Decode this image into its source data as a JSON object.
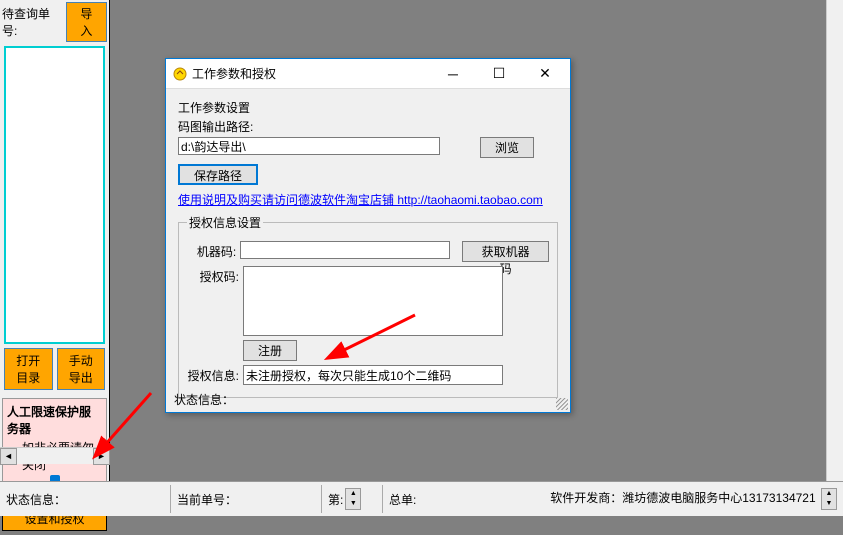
{
  "sidebar": {
    "query_label": "待查询单号:",
    "import_btn": "导入",
    "open_dir_btn": "打开目录",
    "manual_export_btn": "手动导出",
    "rate_limit_title": "人工限速保护服务器",
    "rate_limit_checkbox": "如非必要请勿关闭",
    "rate_limit_checked": true,
    "settings_btn": "设置和授权"
  },
  "dialog": {
    "title": "工作参数和授权",
    "section_params": "工作参数设置",
    "path_label": "码图输出路径:",
    "path_value": "d:\\韵达导出\\",
    "browse_btn": "浏览",
    "save_path_btn": "保存路径",
    "link_text": "使用说明及购买请访问德波软件淘宝店铺  http://taohaomi.taobao.com",
    "link_url": "http://taohaomi.taobao.com",
    "auth_section": "授权信息设置",
    "machine_code_label": "机器码:",
    "machine_code_value": "",
    "get_machine_code_btn": "获取机器码",
    "auth_code_label": "授权码:",
    "auth_code_value": "",
    "register_btn": "注册",
    "auth_info_label": "授权信息:",
    "auth_info_value": "未注册授权，每次只能生成10个二维码",
    "status_label": "状态信息："
  },
  "statusbar": {
    "status_label": "状态信息：",
    "current_order_label": "当前单号：",
    "page_label": "第:",
    "total_label": "总单:",
    "developer": "软件开发商：潍坊德波电脑服务中心13173134721"
  }
}
